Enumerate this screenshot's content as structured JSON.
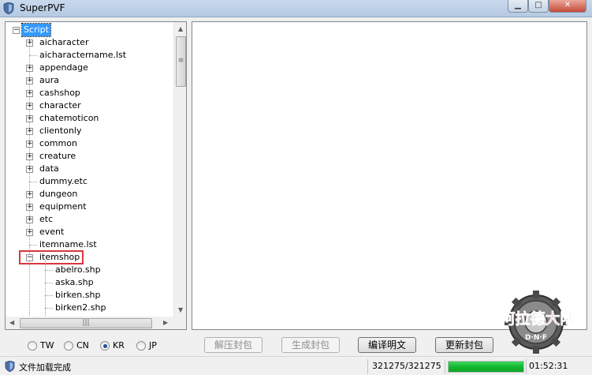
{
  "window": {
    "title": "SuperPVF"
  },
  "tree": {
    "root": "Script",
    "nodes": [
      {
        "label": "aicharacter",
        "expandable": true
      },
      {
        "label": "aicharactername.lst",
        "expandable": false
      },
      {
        "label": "appendage",
        "expandable": true
      },
      {
        "label": "aura",
        "expandable": true
      },
      {
        "label": "cashshop",
        "expandable": true
      },
      {
        "label": "character",
        "expandable": true
      },
      {
        "label": "chatemoticon",
        "expandable": true
      },
      {
        "label": "clientonly",
        "expandable": true
      },
      {
        "label": "common",
        "expandable": true
      },
      {
        "label": "creature",
        "expandable": true
      },
      {
        "label": "data",
        "expandable": true
      },
      {
        "label": "dummy.etc",
        "expandable": false
      },
      {
        "label": "dungeon",
        "expandable": true
      },
      {
        "label": "equipment",
        "expandable": true
      },
      {
        "label": "etc",
        "expandable": true
      },
      {
        "label": "event",
        "expandable": true
      },
      {
        "label": "itemname.lst",
        "expandable": false
      },
      {
        "label": "itemshop",
        "expandable": true,
        "expanded": true,
        "highlighted": true
      }
    ],
    "children": [
      "abelro.shp",
      "aska.shp",
      "birken.shp",
      "birken2.shp"
    ]
  },
  "regions": [
    {
      "label": "TW",
      "selected": false
    },
    {
      "label": "CN",
      "selected": false
    },
    {
      "label": "KR",
      "selected": true
    },
    {
      "label": "JP",
      "selected": false
    }
  ],
  "buttons": {
    "extract": "解压封包",
    "create": "生成封包",
    "compile": "编译明文",
    "update": "更新封包"
  },
  "status": {
    "message": "文件加载完成",
    "count": "321275/321275",
    "progress": 1.0,
    "time": "01:52:31"
  },
  "logo": {
    "text": "阿拉德大陆",
    "sub": "D·N·F"
  },
  "colors": {
    "selection": "#3399ff",
    "highlight_box": "#d9363e",
    "progress": "#14b830"
  }
}
